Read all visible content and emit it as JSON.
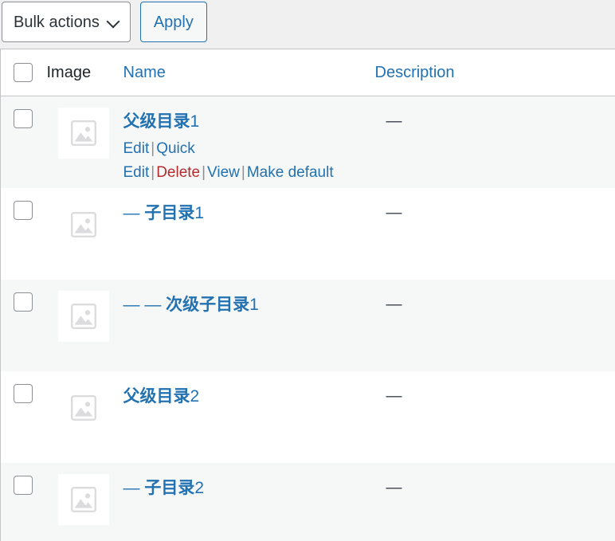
{
  "toolbar": {
    "bulk_actions_label": "Bulk actions",
    "bulk_actions_icon": "chevron-down-icon",
    "apply_label": "Apply"
  },
  "table": {
    "columns": [
      {
        "key": "cb",
        "label": "",
        "type": "checkbox"
      },
      {
        "key": "image",
        "label": "Image",
        "type": "text"
      },
      {
        "key": "name",
        "label": "Name",
        "type": "link"
      },
      {
        "key": "desc",
        "label": "Description",
        "type": "link"
      }
    ],
    "rows": [
      {
        "prefix": "",
        "name": "父级目录",
        "suffix": "1",
        "description": "—",
        "image_icon": "image-placeholder-icon",
        "image_boxed": true,
        "actions": [
          {
            "label": "Edit",
            "style": "link"
          },
          {
            "label": "Quick Edit",
            "style": "link"
          },
          {
            "label": "Delete",
            "style": "delete"
          },
          {
            "label": "View",
            "style": "link"
          },
          {
            "label": "Make default",
            "style": "link"
          }
        ]
      },
      {
        "prefix": "—",
        "name": "子目录",
        "suffix": "1",
        "description": "—",
        "image_icon": "image-placeholder-icon",
        "image_boxed": false,
        "actions": []
      },
      {
        "prefix": "— —",
        "name": "次级子目录",
        "suffix": "1",
        "description": "—",
        "image_icon": "image-placeholder-icon",
        "image_boxed": true,
        "actions": []
      },
      {
        "prefix": "",
        "name": "父级目录",
        "suffix": "2",
        "description": "—",
        "image_icon": "image-placeholder-icon",
        "image_boxed": false,
        "actions": []
      },
      {
        "prefix": "—",
        "name": "子目录",
        "suffix": "2",
        "description": "—",
        "image_icon": "image-placeholder-icon",
        "image_boxed": true,
        "actions": []
      }
    ]
  },
  "colors": {
    "link": "#2271b1",
    "delete": "#b32d2e",
    "text": "#1d2327",
    "admin_bg": "#f0f0f1",
    "stripe": "#f6f7f7",
    "border": "#c3c4c7"
  }
}
